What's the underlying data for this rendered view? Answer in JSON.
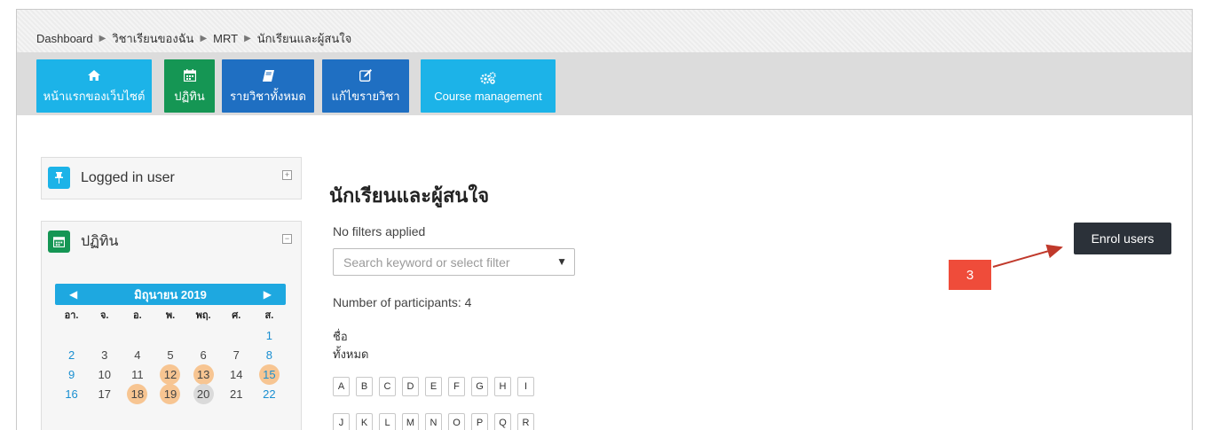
{
  "breadcrumb": {
    "items": [
      "Dashboard",
      "วิชาเรียนของฉัน",
      "MRT",
      "นักเรียนและผู้สนใจ"
    ],
    "separator": "▶"
  },
  "nav": {
    "buttons": [
      {
        "label": "หน้าแรกของเว็บไซต์",
        "icon": "home-icon"
      },
      {
        "label": "ปฏิทิน",
        "icon": "calendar-icon"
      },
      {
        "label": "รายวิชาทั้งหมด",
        "icon": "book-icon"
      },
      {
        "label": "แก้ไขรายวิชา",
        "icon": "edit-icon"
      },
      {
        "label": "Course management",
        "icon": "gears-icon"
      }
    ]
  },
  "blocks": {
    "logged_in": {
      "title": "Logged in user",
      "icon": "pin-icon",
      "toggle": "+"
    },
    "calendar": {
      "title": "ปฏิทิน",
      "icon": "calendar-icon",
      "toggle": "−"
    }
  },
  "calendar": {
    "month": "มิถุนายน 2019",
    "prev": "◀",
    "next": "▶",
    "weekdays": [
      "อา.",
      "จ.",
      "อ.",
      "พ.",
      "พฤ.",
      "ศ.",
      "ส."
    ],
    "rows": [
      [
        "",
        "",
        "",
        "",
        "",
        "",
        "1"
      ],
      [
        "2",
        "3",
        "4",
        "5",
        "6",
        "7",
        "8"
      ],
      [
        "9",
        "10",
        "11",
        "12",
        "13",
        "14",
        "15"
      ],
      [
        "16",
        "17",
        "18",
        "19",
        "20",
        "21",
        "22"
      ]
    ],
    "event_days": [
      "12",
      "13",
      "15",
      "18",
      "19"
    ],
    "today": "20"
  },
  "main": {
    "title": "นักเรียนและผู้สนใจ",
    "filter_status": "No filters applied",
    "search_placeholder": "Search keyword or select filter",
    "dropdown_arrow": "▼",
    "participants": "Number of participants: 4",
    "first_name_label": "ชื่อ",
    "all_label": "ทั้งหมด",
    "letters": [
      "A",
      "B",
      "C",
      "D",
      "E",
      "F",
      "G",
      "H",
      "I",
      "J",
      "K",
      "L",
      "M",
      "N",
      "O",
      "P",
      "Q",
      "R"
    ]
  },
  "enrol_button": "Enrol users",
  "callout_number": "3",
  "colors": {
    "nav_blue": "#1cb3e8",
    "nav_green": "#159654",
    "nav_dark_blue": "#1f6fc2",
    "enrol_dark": "#2b3139",
    "callout_red": "#ef4c3a",
    "event_orange": "#f7c592"
  }
}
